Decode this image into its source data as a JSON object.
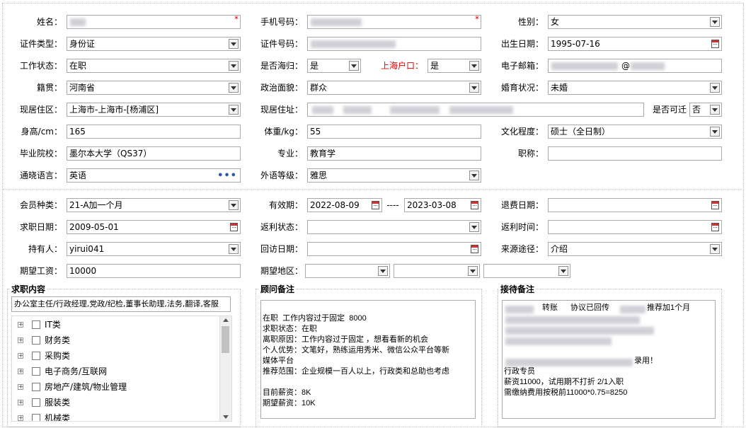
{
  "form": {
    "name_label": "姓名：",
    "phone_label": "手机号码：",
    "gender_label": "性别：",
    "gender_value": "女",
    "id_type_label": "证件类型：",
    "id_type_value": "身份证",
    "id_no_label": "证件号码：",
    "birth_label": "出生日期：",
    "birth_value": "1995-07-16",
    "work_status_label": "工作状态：",
    "work_status_value": "在职",
    "returnee_label": "是否海归：",
    "returnee_value": "是",
    "hukou_label": "上海户口：",
    "hukou_value": "是",
    "email_label": "电子邮箱：",
    "email_at": "@",
    "native_label": "籍贯：",
    "native_value": "河南省",
    "political_label": "政治面貌：",
    "political_value": "群众",
    "marital_label": "婚育状况：",
    "marital_value": "未婚",
    "area_label": "现居住区：",
    "area_value": "上海市-上海市-[杨浦区]",
    "address_label": "现居住址：",
    "relocate_label": "是否可迁",
    "relocate_value": "否",
    "height_label": "身高/cm：",
    "height_value": "165",
    "weight_label": "体重/kg：",
    "weight_value": "55",
    "edu_label": "文化程度：",
    "edu_value": "硕士（全日制）",
    "school_label": "毕业院校：",
    "school_value": "墨尔本大学（QS37）",
    "major_label": "专业：",
    "major_value": "教育学",
    "title_label": "职称：",
    "title_value": "",
    "language_label": "通晓语言：",
    "language_value": "英语",
    "lang_level_label": "外语等级：",
    "lang_level_value": "雅思"
  },
  "member": {
    "type_label": "会员种类：",
    "type_value": "21-A加一个月",
    "valid_label": "有效期：",
    "valid_from": "2022-08-09",
    "valid_sep": "----",
    "valid_to": "2023-03-08",
    "refund_date_label": "退费日期：",
    "refund_date_value": "",
    "job_date_label": "求职日期：",
    "job_date_value": "2009-05-01",
    "rebate_status_label": "返利状态：",
    "rebate_status_value": "",
    "rebate_time_label": "返利时间：",
    "rebate_time_value": "",
    "holder_label": "持有人：",
    "holder_value": "yirui041",
    "visit_date_label": "回访日期：",
    "visit_date_value": "",
    "source_label": "来源途径：",
    "source_value": "介绍",
    "salary_label": "期望工资：",
    "salary_value": "10000",
    "region_label": "期望地区："
  },
  "job_panel": {
    "title": "求职内容",
    "content": "办公室主任/行政经理,党政/纪检,董事长助理,法务,翻译,客服",
    "tree": [
      "IT类",
      "财务类",
      "采购类",
      "电子商务/互联网",
      "房地产/建筑/物业管理",
      "服装类",
      "机械类"
    ]
  },
  "advisor_panel": {
    "title": "顾问备注",
    "lines": [
      "在职  工作内容过于固定  8000",
      "求职状态：在职",
      "离职原因：工作内容过于固定 ，想看看新的机会",
      "个人优势：文笔好，熟练运用秀米、微信公众平台等新",
      "媒体平台",
      "推荐范围：企业规模一百人以上，行政类和总助也考虑",
      "",
      "目前薪资：8K",
      "期望薪资：10K"
    ]
  },
  "reception_panel": {
    "title": "接待备注",
    "line1_a": "转账",
    "line1_b": "协议已回传",
    "line1_c": "推荐加1个月",
    "line5_tail": "录用！",
    "lines": [
      "行政专员",
      "薪资11000，试用期不打折 2/1入职",
      "需缴纳费用按税前11000*0.75=8250"
    ]
  },
  "colors": {
    "hukou_label": "#e00000",
    "link_dots": "#3355aa",
    "required": "#d00000"
  }
}
